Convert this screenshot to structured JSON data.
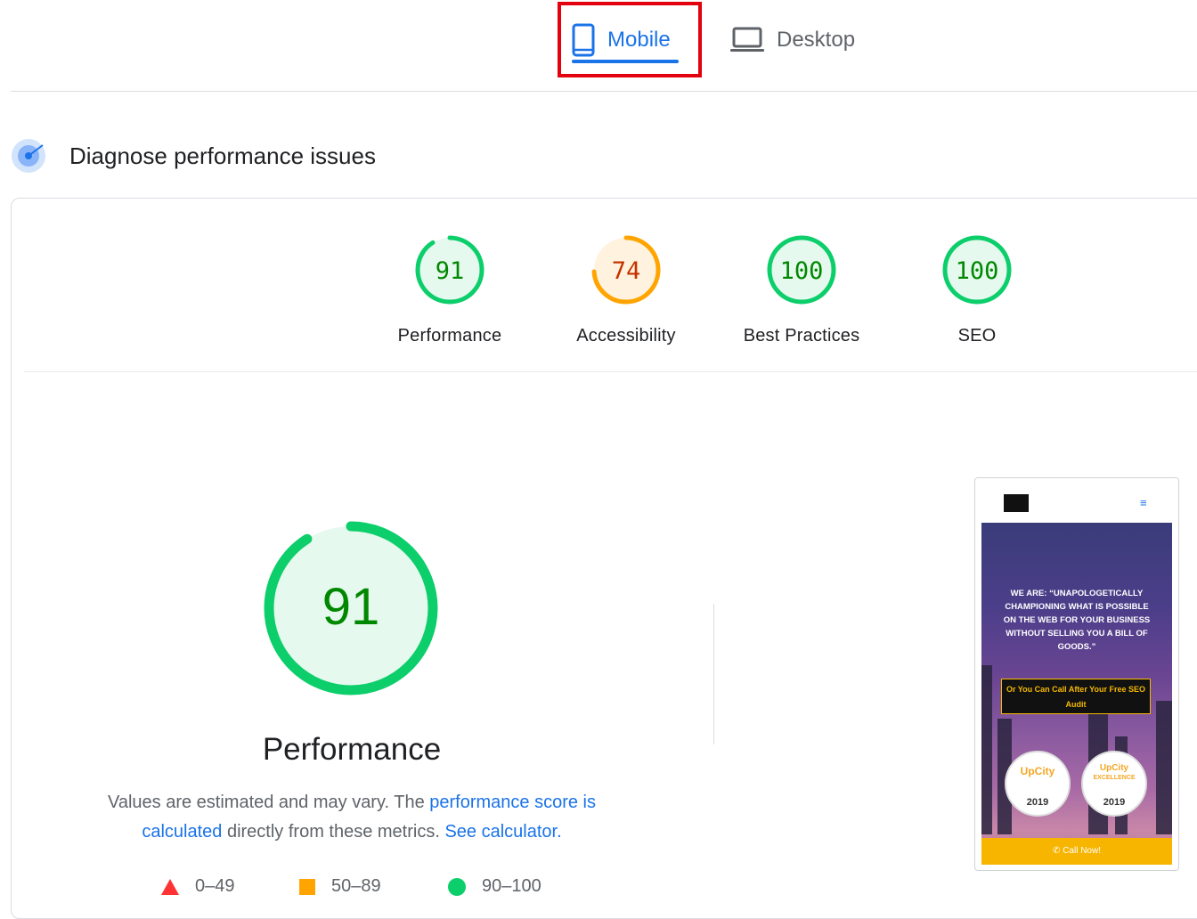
{
  "tabs": {
    "mobile_label": "Mobile",
    "desktop_label": "Desktop"
  },
  "diagnose": {
    "title": "Diagnose performance issues"
  },
  "scores": [
    {
      "value": "91",
      "label": "Performance",
      "score": 91,
      "color": "#0cce6b",
      "text_color": "#008800",
      "bg": "#e6f9ee"
    },
    {
      "value": "74",
      "label": "Accessibility",
      "score": 74,
      "color": "#ffa400",
      "text_color": "#c33300",
      "bg": "#fff3e0"
    },
    {
      "value": "100",
      "label": "Best Practices",
      "score": 100,
      "color": "#0cce6b",
      "text_color": "#008800",
      "bg": "#e6f9ee"
    },
    {
      "value": "100",
      "label": "SEO",
      "score": 100,
      "color": "#0cce6b",
      "text_color": "#008800",
      "bg": "#e6f9ee"
    }
  ],
  "performance": {
    "score": "91",
    "score_value": 91,
    "title": "Performance",
    "desc_prefix": "Values are estimated and may vary. The ",
    "link_score": "performance score is calculated",
    "desc_mid": " directly from these metrics. ",
    "link_calc": "See calculator."
  },
  "legend": [
    {
      "shape": "triangle",
      "range": "0–49",
      "color": "#ff3333"
    },
    {
      "shape": "square",
      "range": "50–89",
      "color": "#ffa400"
    },
    {
      "shape": "circle",
      "range": "90–100",
      "color": "#0cce6b"
    }
  ],
  "thumbnail": {
    "hero_text": "WE ARE: “UNAPOLOGETICALLY CHAMPIONING WHAT IS POSSIBLE ON THE WEB FOR YOUR BUSINESS WITHOUT SELLING YOU A BILL OF GOODS.”",
    "cta": "Or You Can Call After Your Free SEO Audit",
    "badge1": {
      "brand": "UpCity",
      "year": "2019"
    },
    "badge2": {
      "brand": "UpCity",
      "sub": "EXCELLENCE",
      "year": "2019"
    },
    "call": "Call Now!"
  }
}
